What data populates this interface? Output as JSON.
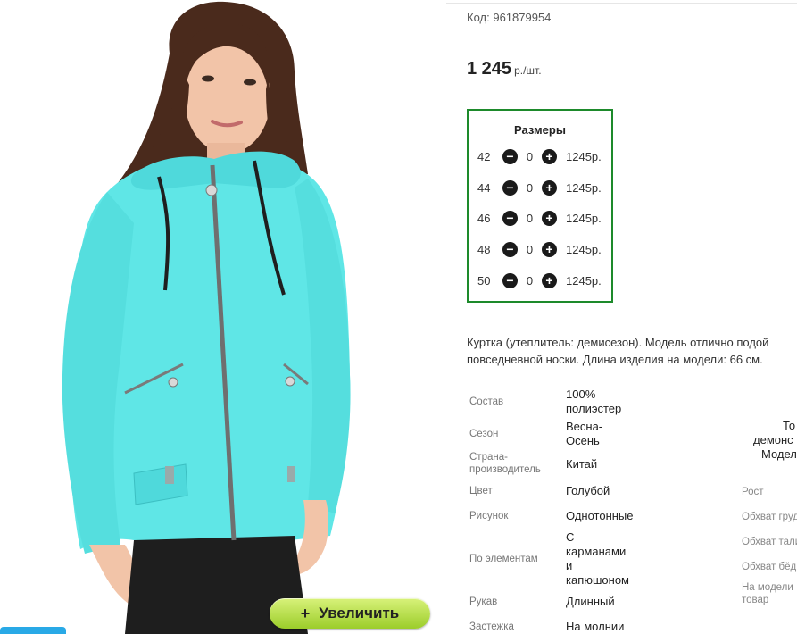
{
  "product": {
    "code_label": "Код:",
    "code": "961879954",
    "price": "1 245",
    "price_unit": "р./шт."
  },
  "zoom_button": {
    "icon": "+",
    "label": "Увеличить"
  },
  "sizes": {
    "title": "Размеры",
    "rows": [
      {
        "size": "42",
        "qty": "0",
        "price": "1245р."
      },
      {
        "size": "44",
        "qty": "0",
        "price": "1245р."
      },
      {
        "size": "46",
        "qty": "0",
        "price": "1245р."
      },
      {
        "size": "48",
        "qty": "0",
        "price": "1245р."
      },
      {
        "size": "50",
        "qty": "0",
        "price": "1245р."
      }
    ]
  },
  "description": {
    "line1": "Куртка (утеплитель: демисезон). Модель отлично подой",
    "line2": "повседневной носки. Длина изделия на модели: 66 см."
  },
  "properties": [
    {
      "label": "Состав",
      "value_lines": [
        "100%",
        "полиэстер"
      ]
    },
    {
      "label": "Сезон",
      "value_lines": [
        "Весна-",
        "Осень"
      ]
    },
    {
      "label_lines": [
        "Страна-",
        "производитель"
      ],
      "value_lines": [
        "Китай"
      ]
    },
    {
      "label": "Цвет",
      "value_lines": [
        "Голубой"
      ]
    },
    {
      "label": "Рисунок",
      "value_lines": [
        "Однотонные"
      ]
    },
    {
      "label": "По элементам",
      "value_lines": [
        "С",
        "карманами",
        "и",
        "капюшоном"
      ]
    },
    {
      "label": "Рукав",
      "value_lines": [
        "Длинный"
      ]
    },
    {
      "label": "Застежка",
      "value_lines": [
        "На молнии"
      ]
    }
  ],
  "model_info": {
    "lines": [
      "То",
      "демонс",
      "Модел"
    ],
    "params": [
      "Рост",
      "Обхват груд",
      "Обхват тали",
      "Обхват бёд",
      "На модели",
      "товар"
    ]
  },
  "colors": {
    "border_green": "#1d8a2b",
    "zoom_button": "#b5dd4a",
    "jacket": "#5fe6e6"
  }
}
